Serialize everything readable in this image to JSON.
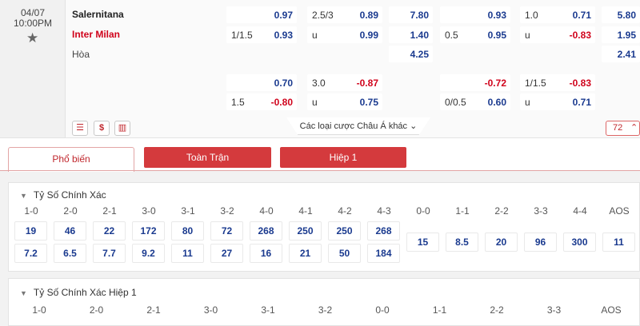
{
  "match": {
    "date": "04/07",
    "time": "10:00PM",
    "home": "Salernitana",
    "away": "Inter Milan",
    "draw": "Hòa"
  },
  "odds": {
    "r1": {
      "b1": {
        "home": "0.97",
        "hcap": "1/1.5",
        "away": "0.93"
      },
      "b2": {
        "line": "2.5/3",
        "over": "0.89",
        "u": "u",
        "under": "0.99"
      },
      "b3": {
        "home": "7.80",
        "away": "1.40",
        "draw": "4.25"
      },
      "b4": {
        "home": "0.93",
        "hcap": "0.5",
        "away": "0.95"
      },
      "b5": {
        "line": "1.0",
        "over": "0.71",
        "u": "u",
        "under": "-0.83"
      },
      "b6": {
        "home": "5.80",
        "away": "1.95",
        "draw": "2.41"
      }
    },
    "r2": {
      "b1": {
        "home": "0.70",
        "hcap": "1.5",
        "away": "-0.80"
      },
      "b2": {
        "line": "3.0",
        "over": "-0.87",
        "u": "u",
        "under": "0.75"
      },
      "b4": {
        "home": "-0.72",
        "hcap": "0/0.5",
        "away": "0.60"
      },
      "b5": {
        "line": "1/1.5",
        "over": "-0.83",
        "u": "u",
        "under": "0.71"
      }
    }
  },
  "toolbar": {
    "icon_money": "$",
    "more_bets": "Các loại cược Châu Á khác",
    "count": "72"
  },
  "tabs": [
    "Phổ biến",
    "Toàn Trận",
    "Hiệp 1"
  ],
  "section1": {
    "title": "Tỷ Số Chính Xác",
    "labels": [
      "1-0",
      "2-0",
      "2-1",
      "3-0",
      "3-1",
      "3-2",
      "4-0",
      "4-1",
      "4-2",
      "4-3",
      "0-0",
      "1-1",
      "2-2",
      "3-3",
      "4-4",
      "AOS"
    ],
    "row1": [
      "19",
      "46",
      "22",
      "172",
      "80",
      "72",
      "268",
      "250",
      "250",
      "268"
    ],
    "row2": [
      "7.2",
      "6.5",
      "7.7",
      "9.2",
      "11",
      "27",
      "16",
      "21",
      "50",
      "184"
    ],
    "mid": [
      "15",
      "8.5",
      "20",
      "96",
      "300",
      "11"
    ]
  },
  "section2": {
    "title": "Tỷ Số Chính Xác Hiệp 1",
    "labels": [
      "1-0",
      "2-0",
      "2-1",
      "3-0",
      "3-1",
      "3-2",
      "0-0",
      "1-1",
      "2-2",
      "3-3",
      "AOS"
    ]
  },
  "colors": {
    "accent": "#d43a3d",
    "odds_blue": "#1a3a8f",
    "negative": "#d0021b"
  }
}
